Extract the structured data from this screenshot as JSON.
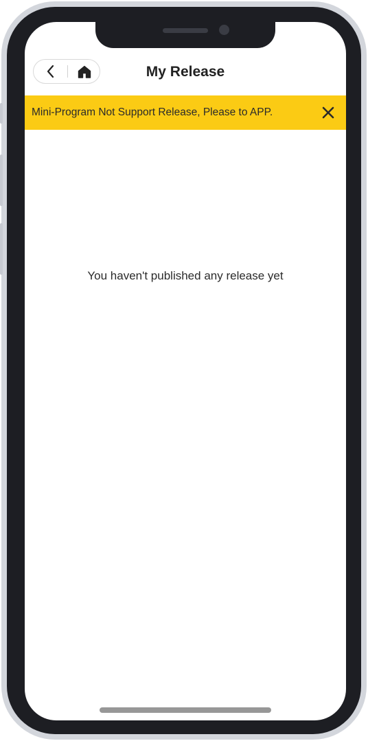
{
  "header": {
    "title": "My Release",
    "back_icon": "chevron-left-icon",
    "home_icon": "home-icon"
  },
  "notice": {
    "text": "Mini-Program Not Support Release, Please to APP.",
    "close_icon": "close-icon",
    "background_color": "#fbcb14"
  },
  "main": {
    "empty_message": "You haven't published any release yet"
  }
}
